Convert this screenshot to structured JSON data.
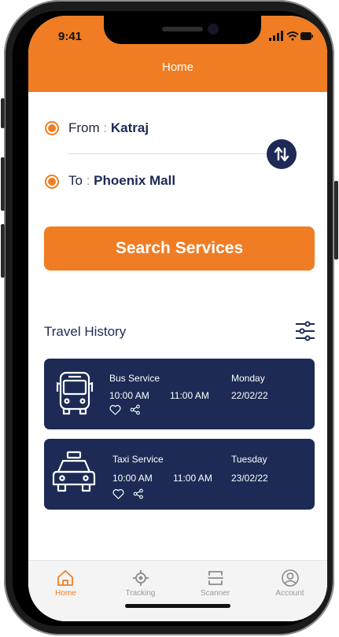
{
  "status_bar": {
    "time": "9:41"
  },
  "header": {
    "title": "Home"
  },
  "route": {
    "from_label": "From",
    "from_value": "Katraj",
    "to_label": "To",
    "to_value": "Phoenix Mall",
    "separator": ":"
  },
  "search_button": {
    "label": "Search Services"
  },
  "travel_history": {
    "title": "Travel History",
    "cards": [
      {
        "service": "Bus Service",
        "day": "Monday",
        "depart": "10:00 AM",
        "arrive": "11:00 AM",
        "date": "22/02/22",
        "icon": "bus-icon"
      },
      {
        "service": "Taxi Service",
        "day": "Tuesday",
        "depart": "10:00 AM",
        "arrive": "11:00 AM",
        "date": "23/02/22",
        "icon": "taxi-icon"
      }
    ]
  },
  "tabs": [
    {
      "label": "Home",
      "icon": "home-icon",
      "active": true
    },
    {
      "label": "Tracking",
      "icon": "tracking-icon",
      "active": false
    },
    {
      "label": "Scanner",
      "icon": "scanner-icon",
      "active": false
    },
    {
      "label": "Account",
      "icon": "account-icon",
      "active": false
    }
  ],
  "colors": {
    "accent": "#f07d23",
    "navy": "#1c2a55",
    "tab_inactive": "#9a9a9a"
  }
}
